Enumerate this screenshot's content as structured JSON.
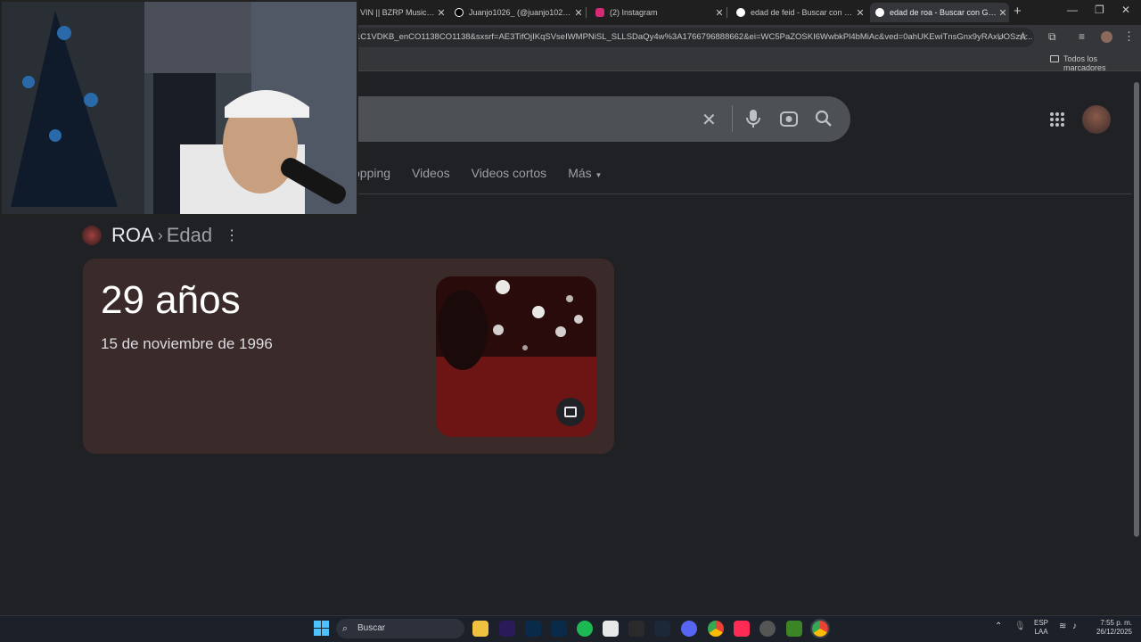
{
  "browser": {
    "tabs": [
      {
        "label": "VIN || BZRP Music Se",
        "favicon_color": "#ff0000"
      },
      {
        "label": "Juanjo1026_ (@juanjo1026_) | T",
        "favicon_color": "#000000"
      },
      {
        "label": "(2) Instagram",
        "favicon_color": "#d62976"
      },
      {
        "label": "edad de feid - Buscar con Goog",
        "favicon_color": "#4285f4"
      },
      {
        "label": "edad de roa - Buscar con Goog",
        "favicon_color": "#4285f4"
      }
    ],
    "new_tab": "+",
    "url": "1C1VDKB_enCO1138CO1138&sxsrf=AE3TifOjIKqSVseIWMPNiSL_SLLSDaQy4w%3A1766796888662&ei=WC5PaZOSKI6WwbkPl4bMiAc&ved=0ahUKEwiTnsGnx9yRAxUOSzA...",
    "bookmarks_label": "Todos los marcadores"
  },
  "search": {
    "clear_icon": "✕",
    "tabs": [
      "opping",
      "Videos",
      "Videos cortos",
      "Más"
    ]
  },
  "result": {
    "entity": "ROA",
    "separator": "›",
    "attribute": "Edad",
    "age": "29 años",
    "birth_date": "15 de noviembre de 1996"
  },
  "taskbar": {
    "search_label": "Buscar",
    "lang_top": "ESP",
    "lang_bottom": "LAA",
    "time": "7:55 p. m.",
    "date": "26/12/2025"
  },
  "colors": {
    "page_bg": "#202124",
    "card_bg": "#3a2a2a"
  }
}
